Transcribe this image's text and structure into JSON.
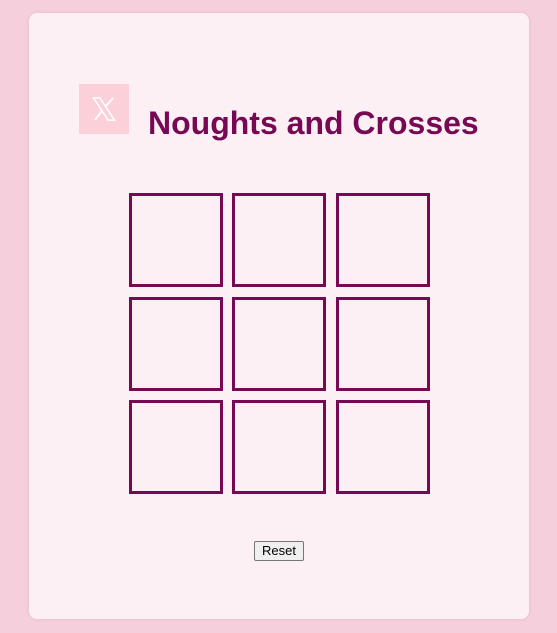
{
  "page": {
    "title": "Noughts and Crosses",
    "logo_icon": "x-logo-icon",
    "colors": {
      "background": "#f6cfdc",
      "card": "#fdf0f4",
      "accent": "#770954",
      "logo_background": "#fbd0d9"
    }
  },
  "board": {
    "cells": [
      "",
      "",
      "",
      "",
      "",
      "",
      "",
      "",
      ""
    ]
  },
  "controls": {
    "reset_label": "Reset"
  }
}
